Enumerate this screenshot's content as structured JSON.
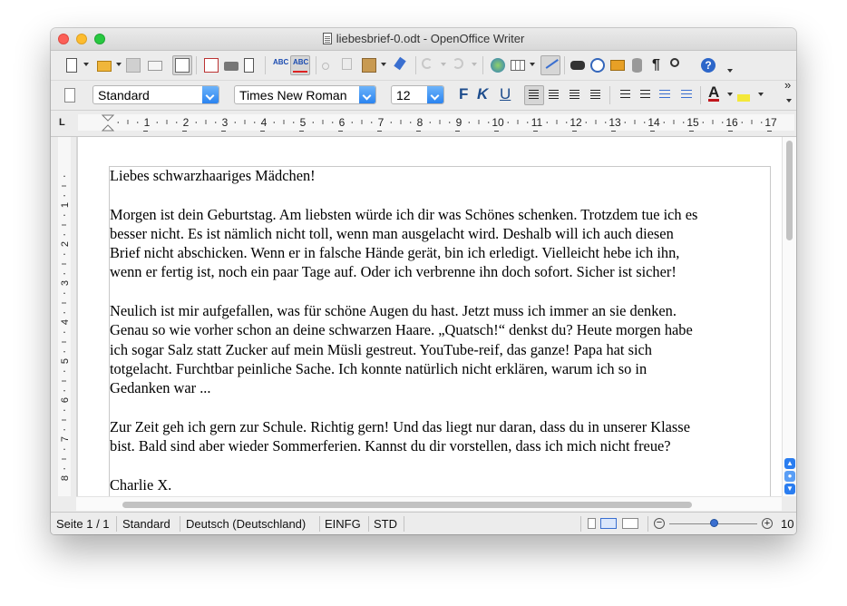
{
  "window": {
    "title": "liebesbrief-0.odt - OpenOffice Writer"
  },
  "toolbar": {
    "paragraph_style": "Standard",
    "font_name": "Times New Roman",
    "font_size": "12",
    "bold_label": "F",
    "italic_label": "K",
    "underline_label": "U",
    "font_color_label": "A",
    "more_label": "»"
  },
  "ruler": {
    "h_numbers": [
      "1",
      "2",
      "3",
      "4",
      "5",
      "6",
      "7",
      "8",
      "9",
      "10",
      "11",
      "12",
      "13",
      "14",
      "15",
      "16",
      "17"
    ],
    "v_numbers": [
      "1",
      "2",
      "3",
      "4",
      "5",
      "6",
      "7",
      "8"
    ],
    "tab_stop_glyph": "L"
  },
  "document": {
    "paragraphs": [
      [
        "Liebes schwarzhaariges Mädchen!"
      ],
      [
        "Morgen ist dein Geburtstag. Am liebsten würde ich dir was Schönes schenken. Trotzdem tue ich es",
        "besser nicht. Es ist nämlich nicht toll, wenn man ausgelacht wird. Deshalb will ich auch diesen",
        "Brief nicht abschicken. Wenn er in falsche Hände gerät, bin ich erledigt. Vielleicht hebe ich ihn,",
        "wenn er fertig ist, noch ein paar Tage auf. Oder ich verbrenne ihn doch sofort. Sicher ist sicher!"
      ],
      [
        "Neulich ist mir aufgefallen, was für schöne Augen du hast. Jetzt muss ich immer an sie denken.",
        "Genau so wie vorher schon an deine schwarzen Haare. „Quatsch!“ denkst du? Heute morgen habe",
        "ich sogar Salz statt Zucker auf mein Müsli gestreut. YouTube-reif, das ganze! Papa hat sich",
        "totgelacht. Furchtbar peinliche Sache. Ich konnte natürlich nicht erklären, warum ich so in",
        "Gedanken war ..."
      ],
      [
        "Zur Zeit geh ich gern zur Schule. Richtig gern! Und das liegt nur daran, dass du in unserer Klasse",
        "bist. Bald sind aber wieder Sommerferien. Kannst du dir vorstellen, dass ich mich nicht freue?"
      ],
      [
        "Charlie X."
      ]
    ]
  },
  "statusbar": {
    "page": "Seite 1 / 1",
    "style": "Standard",
    "language": "Deutsch (Deutschland)",
    "insert_mode": "EINFG",
    "selection_mode": "STD",
    "zoom": "10",
    "zoom_level": 0.5
  },
  "scroll": {
    "vertical_position": 0.0,
    "horizontal_position": 0.1
  },
  "colors": {
    "accent": "#2a83f0",
    "font_color": "#c0161b",
    "highlight": "#f4e83a"
  }
}
